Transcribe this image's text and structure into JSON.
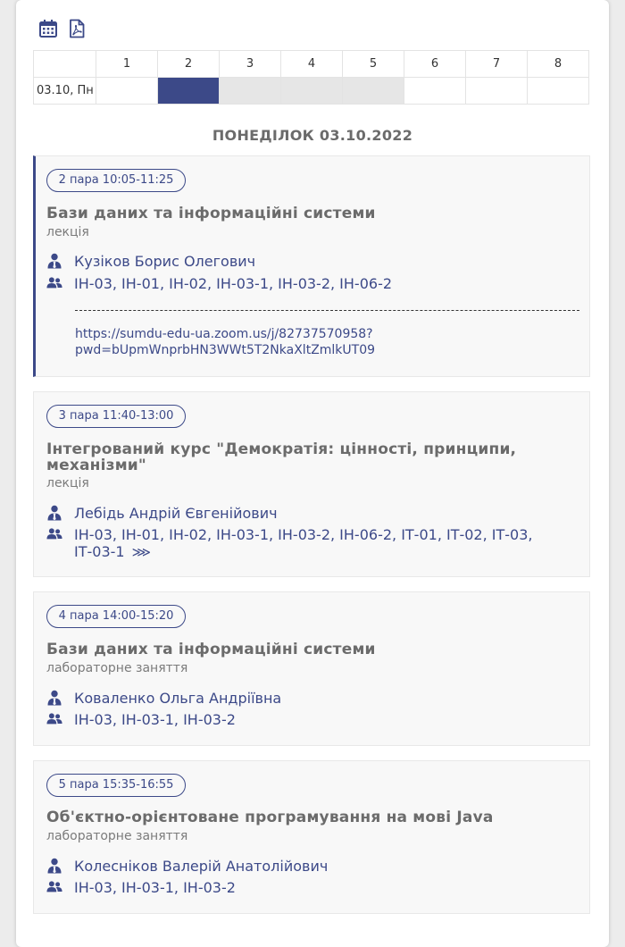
{
  "toolbar": {
    "icons": [
      "calendar-icon",
      "pdf-icon"
    ]
  },
  "grid": {
    "periods": [
      "1",
      "2",
      "3",
      "4",
      "5",
      "6",
      "7",
      "8"
    ],
    "row_label": "03.10, Пн"
  },
  "day_title": "ПОНЕДІЛОК 03.10.2022",
  "lessons": [
    {
      "time": "2 пара 10:05-11:25",
      "subject": "Бази даних та інформаційні системи",
      "type": "лекція",
      "teacher": "Кузіков Борис Олегович",
      "groups": "ІН-03, ІН-01, ІН-02, ІН-03-1, ІН-03-2, ІН-06-2",
      "link_line1": "https://sumdu-edu-ua.zoom.us/j/82737570958?",
      "link_line2": "pwd=bUpmWnprbHN3WWt5T2NkaXltZmlkUT09"
    },
    {
      "time": "3 пара 11:40-13:00",
      "subject_line1": "Інтегрований курс \"Демократія: цінності, принципи,",
      "subject_line2": "механізми\"",
      "type": "лекція",
      "teacher": "Лебідь Андрій Євгенійович",
      "groups_line1": "ІН-03, ІН-01, ІН-02, ІН-03-1, ІН-03-2, ІН-06-2, ІТ-01, ІТ-02, ІТ-03,",
      "groups_line2": "ІТ-03-1",
      "more": "⋙"
    },
    {
      "time": "4 пара 14:00-15:20",
      "subject": "Бази даних та інформаційні системи",
      "type": "лабораторне заняття",
      "teacher": "Коваленко Ольга Андріївна",
      "groups": "ІН-03, ІН-03-1, ІН-03-2"
    },
    {
      "time": "5 пара 15:35-16:55",
      "subject": "Об'єктно-орієнтоване програмування на мові Java",
      "type": "лабораторне заняття",
      "teacher": "Колесніков Валерій Анатолійович",
      "groups": "ІН-03, ІН-03-1, ІН-03-2"
    }
  ],
  "colors": {
    "accent": "#3c4988",
    "muted": "#6b6b6b",
    "slot_unavailable": "#e6e6e6"
  }
}
